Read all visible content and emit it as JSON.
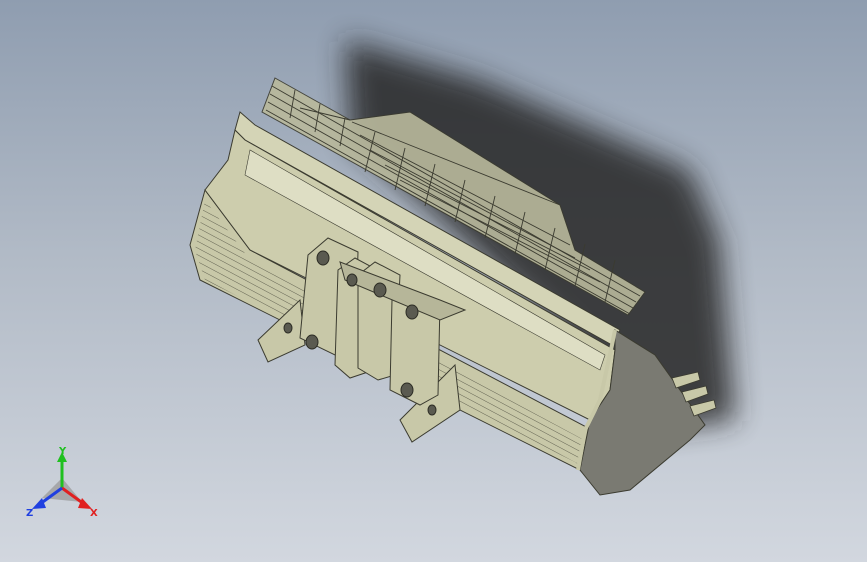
{
  "viewport": {
    "background_top": "#8f9db0",
    "background_bottom": "#d2d7df",
    "model_fill": "#c8c8a8",
    "model_stroke": "#3b3b30",
    "shadow_color": "#2a2a2a"
  },
  "triad": {
    "x_label": "X",
    "y_label": "Y",
    "z_label": "Z",
    "x_color": "#e02020",
    "y_color": "#20c020",
    "z_color": "#2040e0"
  }
}
